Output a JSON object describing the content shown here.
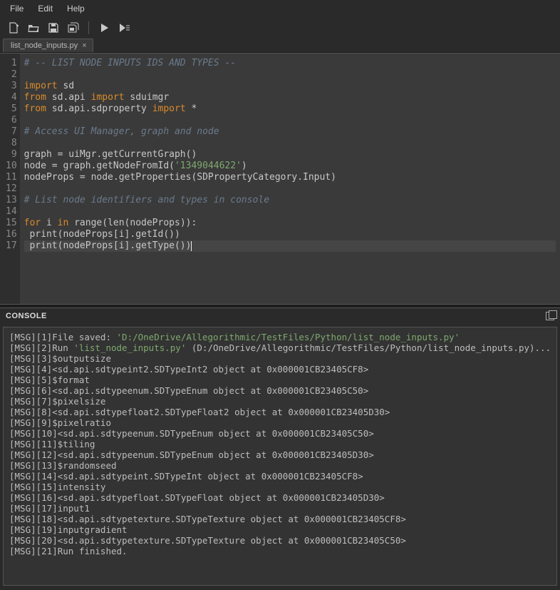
{
  "menu": {
    "file": "File",
    "edit": "Edit",
    "help": "Help"
  },
  "tab": {
    "label": "list_node_inputs.py"
  },
  "code": {
    "lines": [
      {
        "n": 1,
        "cls": "",
        "segs": [
          {
            "c": "cm",
            "t": "# -- LIST NODE INPUTS IDS AND TYPES --"
          }
        ]
      },
      {
        "n": 2,
        "cls": "",
        "segs": []
      },
      {
        "n": 3,
        "cls": "",
        "segs": [
          {
            "c": "kw",
            "t": "import"
          },
          {
            "c": "id",
            "t": " sd"
          }
        ]
      },
      {
        "n": 4,
        "cls": "",
        "segs": [
          {
            "c": "kw",
            "t": "from"
          },
          {
            "c": "id",
            "t": " sd.api "
          },
          {
            "c": "kw",
            "t": "import"
          },
          {
            "c": "id",
            "t": " sduimgr"
          }
        ]
      },
      {
        "n": 5,
        "cls": "",
        "segs": [
          {
            "c": "kw",
            "t": "from"
          },
          {
            "c": "id",
            "t": " sd.api.sdproperty "
          },
          {
            "c": "kw",
            "t": "import"
          },
          {
            "c": "id",
            "t": " *"
          }
        ]
      },
      {
        "n": 6,
        "cls": "",
        "segs": []
      },
      {
        "n": 7,
        "cls": "",
        "segs": [
          {
            "c": "cm",
            "t": "# Access UI Manager, graph and node"
          }
        ]
      },
      {
        "n": 8,
        "cls": "",
        "segs": []
      },
      {
        "n": 9,
        "cls": "",
        "segs": [
          {
            "c": "id",
            "t": "graph = uiMgr.getCurrentGraph()"
          }
        ]
      },
      {
        "n": 10,
        "cls": "",
        "segs": [
          {
            "c": "id",
            "t": "node = graph.getNodeFromId("
          },
          {
            "c": "str",
            "t": "'1349044622'"
          },
          {
            "c": "id",
            "t": ")"
          }
        ]
      },
      {
        "n": 11,
        "cls": "",
        "segs": [
          {
            "c": "id",
            "t": "nodeProps = node.getProperties(SDPropertyCategory.Input)"
          }
        ]
      },
      {
        "n": 12,
        "cls": "",
        "segs": []
      },
      {
        "n": 13,
        "cls": "",
        "segs": [
          {
            "c": "cm",
            "t": "# List node identifiers and types in console"
          }
        ]
      },
      {
        "n": 14,
        "cls": "",
        "segs": []
      },
      {
        "n": 15,
        "cls": "",
        "segs": [
          {
            "c": "kw",
            "t": "for"
          },
          {
            "c": "id",
            "t": " i "
          },
          {
            "c": "kw",
            "t": "in"
          },
          {
            "c": "id",
            "t": " range(len(nodeProps)):"
          }
        ]
      },
      {
        "n": 16,
        "cls": "",
        "segs": [
          {
            "c": "id",
            "t": " print(nodeProps[i].getId())"
          }
        ]
      },
      {
        "n": 17,
        "cls": "cur",
        "segs": [
          {
            "c": "id",
            "t": " print(nodeProps[i].getType())"
          }
        ],
        "caret": true
      }
    ]
  },
  "consoleTitle": "CONSOLE",
  "console": [
    [
      {
        "c": "cgrey",
        "t": "[MSG][1]File saved: "
      },
      {
        "c": "cgreen",
        "t": "'D:/OneDrive/Allegorithmic/TestFiles/Python/list_node_inputs.py'"
      }
    ],
    [
      {
        "c": "cgrey",
        "t": "[MSG][2]Run "
      },
      {
        "c": "cgreen",
        "t": "'list_node_inputs.py'"
      },
      {
        "c": "cgrey",
        "t": " (D:/OneDrive/Allegorithmic/TestFiles/Python/list_node_inputs.py)..."
      }
    ],
    [
      {
        "c": "cgrey",
        "t": "[MSG][3]$outputsize"
      }
    ],
    [
      {
        "c": "cgrey",
        "t": "[MSG][4]<sd.api.sdtypeint2.SDTypeInt2 object at 0x000001CB23405CF8>"
      }
    ],
    [
      {
        "c": "cgrey",
        "t": "[MSG][5]$format"
      }
    ],
    [
      {
        "c": "cgrey",
        "t": "[MSG][6]<sd.api.sdtypeenum.SDTypeEnum object at 0x000001CB23405C50>"
      }
    ],
    [
      {
        "c": "cgrey",
        "t": "[MSG][7]$pixelsize"
      }
    ],
    [
      {
        "c": "cgrey",
        "t": "[MSG][8]<sd.api.sdtypefloat2.SDTypeFloat2 object at 0x000001CB23405D30>"
      }
    ],
    [
      {
        "c": "cgrey",
        "t": "[MSG][9]$pixelratio"
      }
    ],
    [
      {
        "c": "cgrey",
        "t": "[MSG][10]<sd.api.sdtypeenum.SDTypeEnum object at 0x000001CB23405C50>"
      }
    ],
    [
      {
        "c": "cgrey",
        "t": "[MSG][11]$tiling"
      }
    ],
    [
      {
        "c": "cgrey",
        "t": "[MSG][12]<sd.api.sdtypeenum.SDTypeEnum object at 0x000001CB23405D30>"
      }
    ],
    [
      {
        "c": "cgrey",
        "t": "[MSG][13]$randomseed"
      }
    ],
    [
      {
        "c": "cgrey",
        "t": "[MSG][14]<sd.api.sdtypeint.SDTypeInt object at 0x000001CB23405CF8>"
      }
    ],
    [
      {
        "c": "cgrey",
        "t": "[MSG][15]intensity"
      }
    ],
    [
      {
        "c": "cgrey",
        "t": "[MSG][16]<sd.api.sdtypefloat.SDTypeFloat object at 0x000001CB23405D30>"
      }
    ],
    [
      {
        "c": "cgrey",
        "t": "[MSG][17]input1"
      }
    ],
    [
      {
        "c": "cgrey",
        "t": "[MSG][18]<sd.api.sdtypetexture.SDTypeTexture object at 0x000001CB23405CF8>"
      }
    ],
    [
      {
        "c": "cgrey",
        "t": "[MSG][19]inputgradient"
      }
    ],
    [
      {
        "c": "cgrey",
        "t": "[MSG][20]<sd.api.sdtypetexture.SDTypeTexture object at 0x000001CB23405C50>"
      }
    ],
    [
      {
        "c": "cgrey",
        "t": "[MSG][21]Run finished."
      }
    ]
  ]
}
